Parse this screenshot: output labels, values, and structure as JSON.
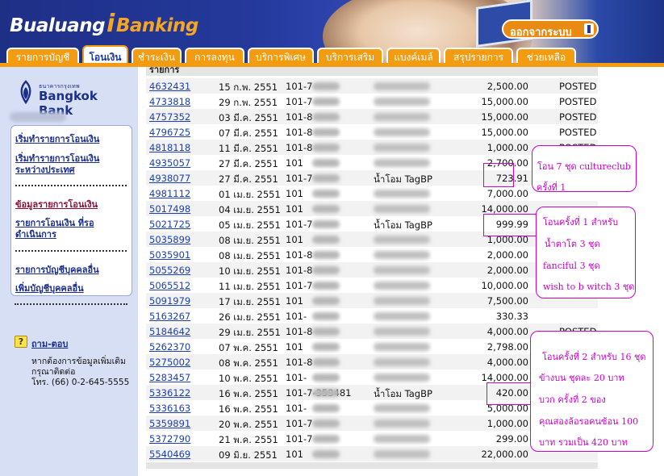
{
  "header": {
    "logo_left": "Bualuang",
    "logo_mark": "i",
    "logo_right": "Banking",
    "logout_label": "ออกจากระบบ"
  },
  "tabs": [
    {
      "label": "รายการบัญชี",
      "active": false
    },
    {
      "label": "โอนเงิน",
      "active": true
    },
    {
      "label": "ชำระเงิน",
      "active": false
    },
    {
      "label": "การลงทุน",
      "active": false
    },
    {
      "label": "บริการพิเศษ",
      "active": false
    },
    {
      "label": "บริการเสริม",
      "active": false
    },
    {
      "label": "แบงค์เมล์",
      "active": false
    },
    {
      "label": "สรุปรายการ",
      "active": false
    },
    {
      "label": "ช่วยเหลือ",
      "active": false
    }
  ],
  "sidebar": {
    "bank_thai": "ธนาคารกรุงเทพ",
    "bank_english": "Bangkok Bank",
    "menu": [
      {
        "label": "เริ่มทำรายการโอนเงิน"
      },
      {
        "label": "เริ่มทำรายการโอนเงิน ระหว่างประเทศ"
      },
      {
        "label": "ข้อมูลรายการโอนเงิน"
      },
      {
        "label": "รายการโอนเงิน ที่รอดำเนินการ"
      },
      {
        "label": "รายการบัญชีบุคคลอื่น"
      },
      {
        "label": "เพิ่มบัญชีบุคคลอื่น"
      }
    ],
    "faq_label": "ถาม-ตอบ",
    "faq_line1": "หากต้องการข้อมูลเพิ่มเติม",
    "faq_line2": "กรุณาติดต่อ",
    "faq_line3": "โทร. (66) 0-2-645-5555"
  },
  "table": {
    "header_partial": "รายการ",
    "rows": [
      {
        "id": "4632431",
        "date": "15 ก.พ. 2551",
        "acct": "101-7",
        "desc": "",
        "amount": "2,500.00",
        "status": "POSTED"
      },
      {
        "id": "4733818",
        "date": "29 ก.พ. 2551",
        "acct": "101-7",
        "desc": "",
        "amount": "15,000.00",
        "status": "POSTED"
      },
      {
        "id": "4757352",
        "date": "03 มี.ค. 2551",
        "acct": "101-8",
        "desc": "",
        "amount": "15,000.00",
        "status": "POSTED"
      },
      {
        "id": "4796725",
        "date": "07 มี.ค. 2551",
        "acct": "101-8",
        "desc": "",
        "amount": "15,000.00",
        "status": "POSTED"
      },
      {
        "id": "4818118",
        "date": "11 มี.ค. 2551",
        "acct": "101-8",
        "desc": "",
        "amount": "1,000.00",
        "status": "POSTED"
      },
      {
        "id": "4935057",
        "date": "27 มี.ค. 2551",
        "acct": "101",
        "desc": "",
        "amount": "2,700.00",
        "status": ""
      },
      {
        "id": "4938077",
        "date": "27 มี.ค. 2551",
        "acct": "101-7",
        "desc": "น้ำโอม TagBP",
        "amount": "723.91",
        "status": ""
      },
      {
        "id": "4981112",
        "date": "01 เม.ย. 2551",
        "acct": "101",
        "desc": "",
        "amount": "7,000.00",
        "status": ""
      },
      {
        "id": "5017498",
        "date": "04 เม.ย. 2551",
        "acct": "101",
        "desc": "",
        "amount": "14,000.00",
        "status": ""
      },
      {
        "id": "5021725",
        "date": "05 เม.ย. 2551",
        "acct": "101-7",
        "desc": "น้ำโอม TagBP",
        "amount": "999.99",
        "status": ""
      },
      {
        "id": "5035899",
        "date": "08 เม.ย. 2551",
        "acct": "101",
        "desc": "",
        "amount": "1,000.00",
        "status": ""
      },
      {
        "id": "5035901",
        "date": "08 เม.ย. 2551",
        "acct": "101-8",
        "desc": "",
        "amount": "2,000.00",
        "status": ""
      },
      {
        "id": "5055269",
        "date": "10 เม.ย. 2551",
        "acct": "101-8",
        "desc": "",
        "amount": "2,000.00",
        "status": ""
      },
      {
        "id": "5065512",
        "date": "11 เม.ย. 2551",
        "acct": "101-7",
        "desc": "",
        "amount": "10,000.00",
        "status": ""
      },
      {
        "id": "5091979",
        "date": "17 เม.ย. 2551",
        "acct": "101",
        "desc": "",
        "amount": "7,500.00",
        "status": ""
      },
      {
        "id": "5163267",
        "date": "26 เม.ย. 2551",
        "acct": "101-",
        "desc": "",
        "amount": "330.33",
        "status": ""
      },
      {
        "id": "5184642",
        "date": "29 เม.ย. 2551",
        "acct": "101-8",
        "desc": "",
        "amount": "4,000.00",
        "status": "POSTED"
      },
      {
        "id": "5262370",
        "date": "07 พ.ค. 2551",
        "acct": "101",
        "desc": "",
        "amount": "2,798.00",
        "status": ""
      },
      {
        "id": "5275002",
        "date": "08 พ.ค. 2551",
        "acct": "101-8",
        "desc": "",
        "amount": "4,000.00",
        "status": ""
      },
      {
        "id": "5283457",
        "date": "10 พ.ค. 2551",
        "acct": "101-",
        "desc": "",
        "amount": "14,000.00",
        "status": ""
      },
      {
        "id": "5336122",
        "date": "16 พ.ค. 2551",
        "acct": "101-7-353481",
        "desc": "น้ำโอม TagBP",
        "amount": "420.00",
        "status": ""
      },
      {
        "id": "5336163",
        "date": "16 พ.ค. 2551",
        "acct": "101-",
        "desc": "",
        "amount": "5,000.00",
        "status": ""
      },
      {
        "id": "5359891",
        "date": "20 พ.ค. 2551",
        "acct": "101-7",
        "desc": "",
        "amount": "1,000.00",
        "status": ""
      },
      {
        "id": "5372790",
        "date": "21 พ.ค. 2551",
        "acct": "101-7",
        "desc": "",
        "amount": "299.00",
        "status": ""
      },
      {
        "id": "5540469",
        "date": "09 มิ.ย. 2551",
        "acct": "101",
        "desc": "",
        "amount": "22,000.00",
        "status": ""
      }
    ]
  },
  "annotations": {
    "note1_line1": "โอน 7 ชุด cultureclub",
    "note1_line2": "ครั้งที่ 1",
    "note2_line1": "โอนครั้งที่ 1 สำหรับ",
    "note2_line2": "น้ำตาโต 3 ชุด",
    "note2_line3": "fanciful 3 ชุด",
    "note2_line4": "wish to b witch 3 ชุด",
    "note3_line1": "โอนครั้งที่ 2 สำหรับ 16 ชุด",
    "note3_line2": "ข้างบน ชุดละ 20 บาท",
    "note3_line3": "บวก ครั้งที่ 2 ของ",
    "note3_line4": "คุณสองล้อรอคนซ้อน  100",
    "note3_line5": "บาท  รวมเป็น 420 บาท"
  },
  "colors": {
    "tab_orange": "#f39c12",
    "sidebar_bg": "#d7dff5",
    "link_blue": "#1c3fb3",
    "annotation_magenta": "#cc00cc"
  }
}
